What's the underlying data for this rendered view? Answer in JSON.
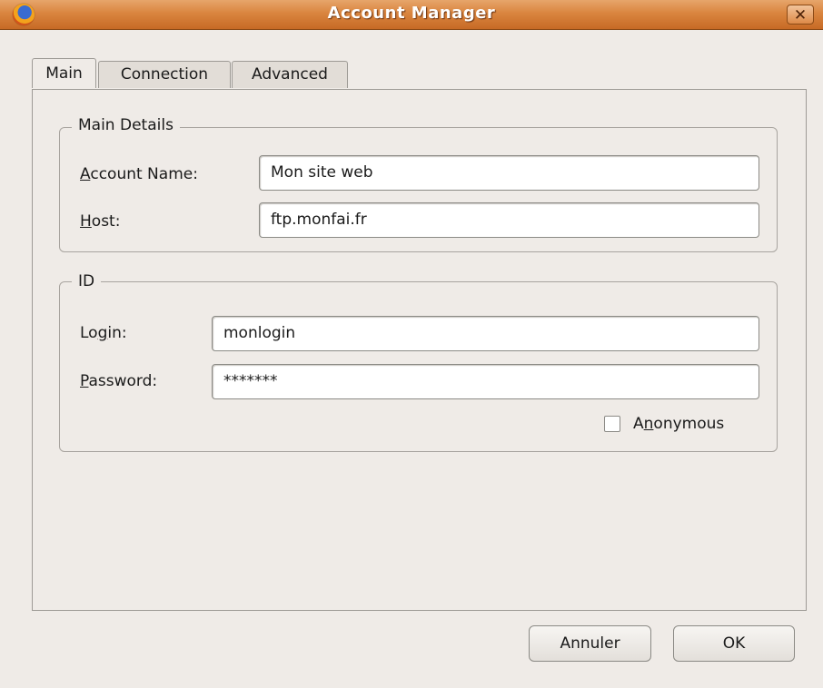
{
  "window": {
    "title": "Account Manager",
    "close_glyph": "✕"
  },
  "tabs": [
    {
      "label": "Main",
      "active": true
    },
    {
      "label": "Connection",
      "active": false
    },
    {
      "label": "Advanced",
      "active": false
    }
  ],
  "main_details": {
    "legend": "Main Details",
    "account_name": {
      "label_mnemonic": "A",
      "label_rest": "ccount Name:",
      "value": "Mon site web"
    },
    "host": {
      "label_mnemonic": "H",
      "label_rest": "ost:",
      "value": "ftp.monfai.fr"
    }
  },
  "id_group": {
    "legend": "ID",
    "login": {
      "label_pre": "Lo",
      "label_mnemonic": "g",
      "label_rest": "in:",
      "value": "monlogin"
    },
    "password": {
      "label_mnemonic": "P",
      "label_rest": "assword:",
      "value": "*******"
    },
    "anonymous": {
      "label_pre": "A",
      "label_mnemonic": "n",
      "label_rest": "onymous",
      "checked": false
    }
  },
  "buttons": {
    "cancel": "Annuler",
    "ok": "OK"
  },
  "colors": {
    "titlebar": "#d9853f",
    "window_bg": "#efebe7"
  },
  "icons": {
    "app": "firefox-icon",
    "close": "close-icon"
  }
}
